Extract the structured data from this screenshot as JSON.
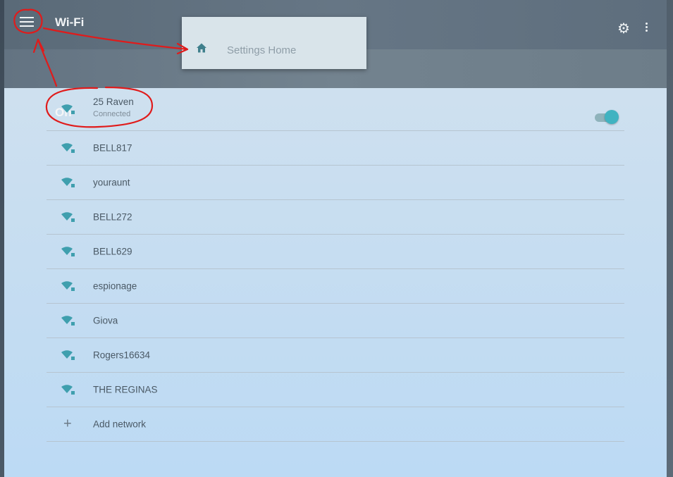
{
  "appbar": {
    "title": "Wi-Fi",
    "menu_icon": "menu-icon",
    "settings_icon": "gear-icon",
    "overflow_icon": "more-vert-icon"
  },
  "wifi_toggle": {
    "label": "On",
    "state": "on"
  },
  "dropdown": {
    "icon": "home-icon",
    "label": "Settings Home"
  },
  "networks": [
    {
      "name": "25 Raven",
      "status": "Connected"
    },
    {
      "name": "BELL817"
    },
    {
      "name": "youraunt"
    },
    {
      "name": "BELL272"
    },
    {
      "name": "BELL629"
    },
    {
      "name": "espionage"
    },
    {
      "name": "Giova"
    },
    {
      "name": "Rogers16634"
    },
    {
      "name": "THE REGINAS"
    }
  ],
  "add_network": {
    "icon": "plus-icon",
    "label": "Add network"
  },
  "colors": {
    "accent": "#40b3c1",
    "annotation": "#e01b1b",
    "appbar": "#637382"
  }
}
